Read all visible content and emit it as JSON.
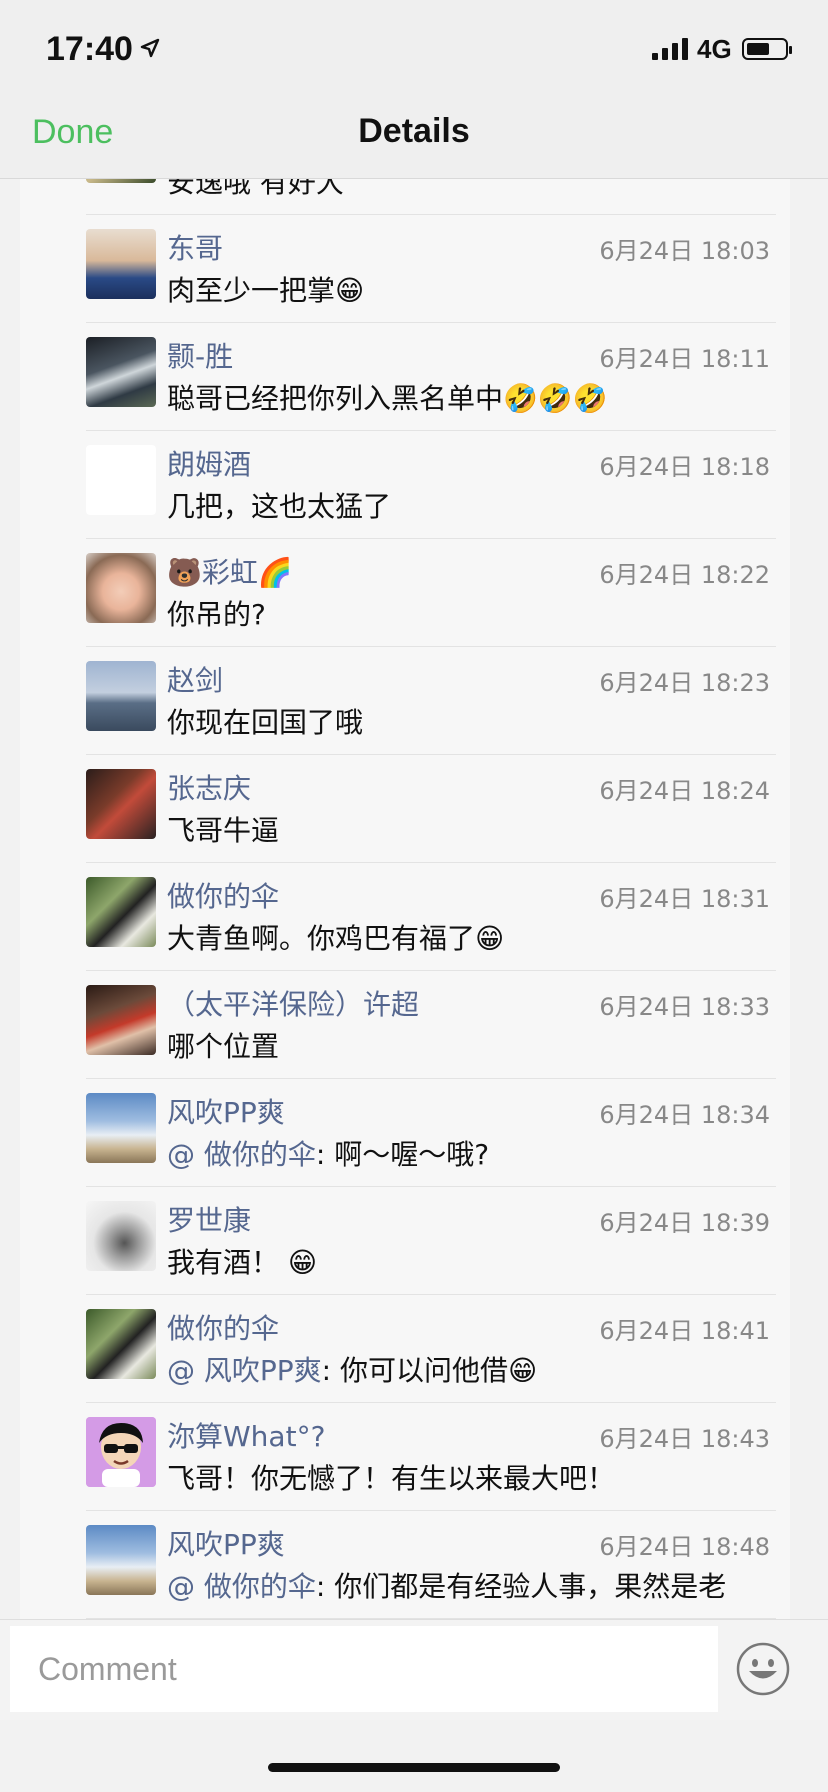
{
  "status": {
    "time": "17:40",
    "network": "4G"
  },
  "nav": {
    "done": "Done",
    "title": "Details"
  },
  "partial_top": {
    "text": "安逸哦 有好大"
  },
  "comments": [
    {
      "name": "东哥",
      "time": "6月24日 18:03",
      "text": "肉至少一把掌😁"
    },
    {
      "name": "颢-胜",
      "time": "6月24日 18:11",
      "text": "聪哥已经把你列入黑名单中🤣🤣🤣"
    },
    {
      "name": "朗姆酒",
      "time": "6月24日 18:18",
      "text": "几把，这也太猛了"
    },
    {
      "name": "🐻彩虹🌈",
      "time": "6月24日 18:22",
      "text": "你吊的?"
    },
    {
      "name": "赵剑",
      "time": "6月24日 18:23",
      "text": "你现在回国了哦"
    },
    {
      "name": "张志庆",
      "time": "6月24日 18:24",
      "text": "飞哥牛逼"
    },
    {
      "name": "做你的伞",
      "time": "6月24日 18:31",
      "text": "大青鱼啊。你鸡巴有福了😁"
    },
    {
      "name": "（太平洋保险）许超",
      "time": "6月24日 18:33",
      "text": "哪个位置"
    },
    {
      "name": "风吹PP爽",
      "time": "6月24日 18:34",
      "mention": "@ 做你的伞",
      "text": ": 啊～喔～哦?"
    },
    {
      "name": "罗世康",
      "time": "6月24日 18:39",
      "text": "我有酒！ 😁"
    },
    {
      "name": "做你的伞",
      "time": "6月24日 18:41",
      "mention": "@ 风吹PP爽",
      "text": ": 你可以问他借😁"
    },
    {
      "name": "沵算What°?",
      "time": "6月24日 18:43",
      "text": "飞哥！你无憾了！有生以来最大吧！"
    },
    {
      "name": "风吹PP爽",
      "time": "6月24日 18:48",
      "mention": "@ 做你的伞",
      "text": ": 你们都是有经验人事，果然是老"
    }
  ],
  "comment_bar": {
    "placeholder": "Comment"
  },
  "colors": {
    "accent": "#4cbf5f",
    "name": "#55678f"
  }
}
